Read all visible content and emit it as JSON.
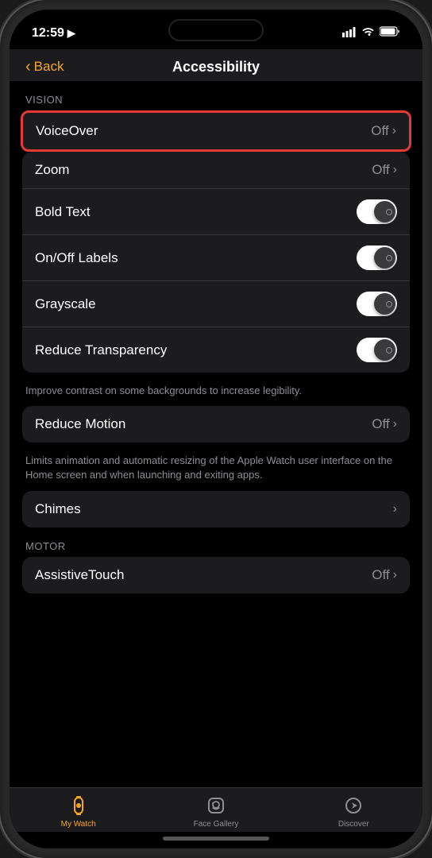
{
  "status": {
    "time": "12:59",
    "location_icon": "▶",
    "signal": "▪▪▪",
    "wifi": "wifi",
    "battery": "battery"
  },
  "header": {
    "back_label": "Back",
    "title": "Accessibility"
  },
  "sections": {
    "vision_label": "VISION",
    "motor_label": "MOTOR"
  },
  "rows": {
    "voiceover": {
      "label": "VoiceOver",
      "value": "Off"
    },
    "zoom": {
      "label": "Zoom",
      "value": "Off"
    },
    "bold_text": {
      "label": "Bold Text"
    },
    "on_off_labels": {
      "label": "On/Off Labels"
    },
    "grayscale": {
      "label": "Grayscale"
    },
    "reduce_transparency": {
      "label": "Reduce Transparency"
    },
    "reduce_transparency_hint": "Improve contrast on some backgrounds to increase legibility.",
    "reduce_motion": {
      "label": "Reduce Motion",
      "value": "Off"
    },
    "reduce_motion_hint": "Limits animation and automatic resizing of the Apple Watch user interface on the Home screen and when launching and exiting apps.",
    "chimes": {
      "label": "Chimes"
    },
    "assistive_touch": {
      "label": "AssistiveTouch",
      "value": "Off"
    }
  },
  "tabs": {
    "my_watch": {
      "label": "My Watch"
    },
    "face_gallery": {
      "label": "Face Gallery"
    },
    "discover": {
      "label": "Discover"
    }
  }
}
